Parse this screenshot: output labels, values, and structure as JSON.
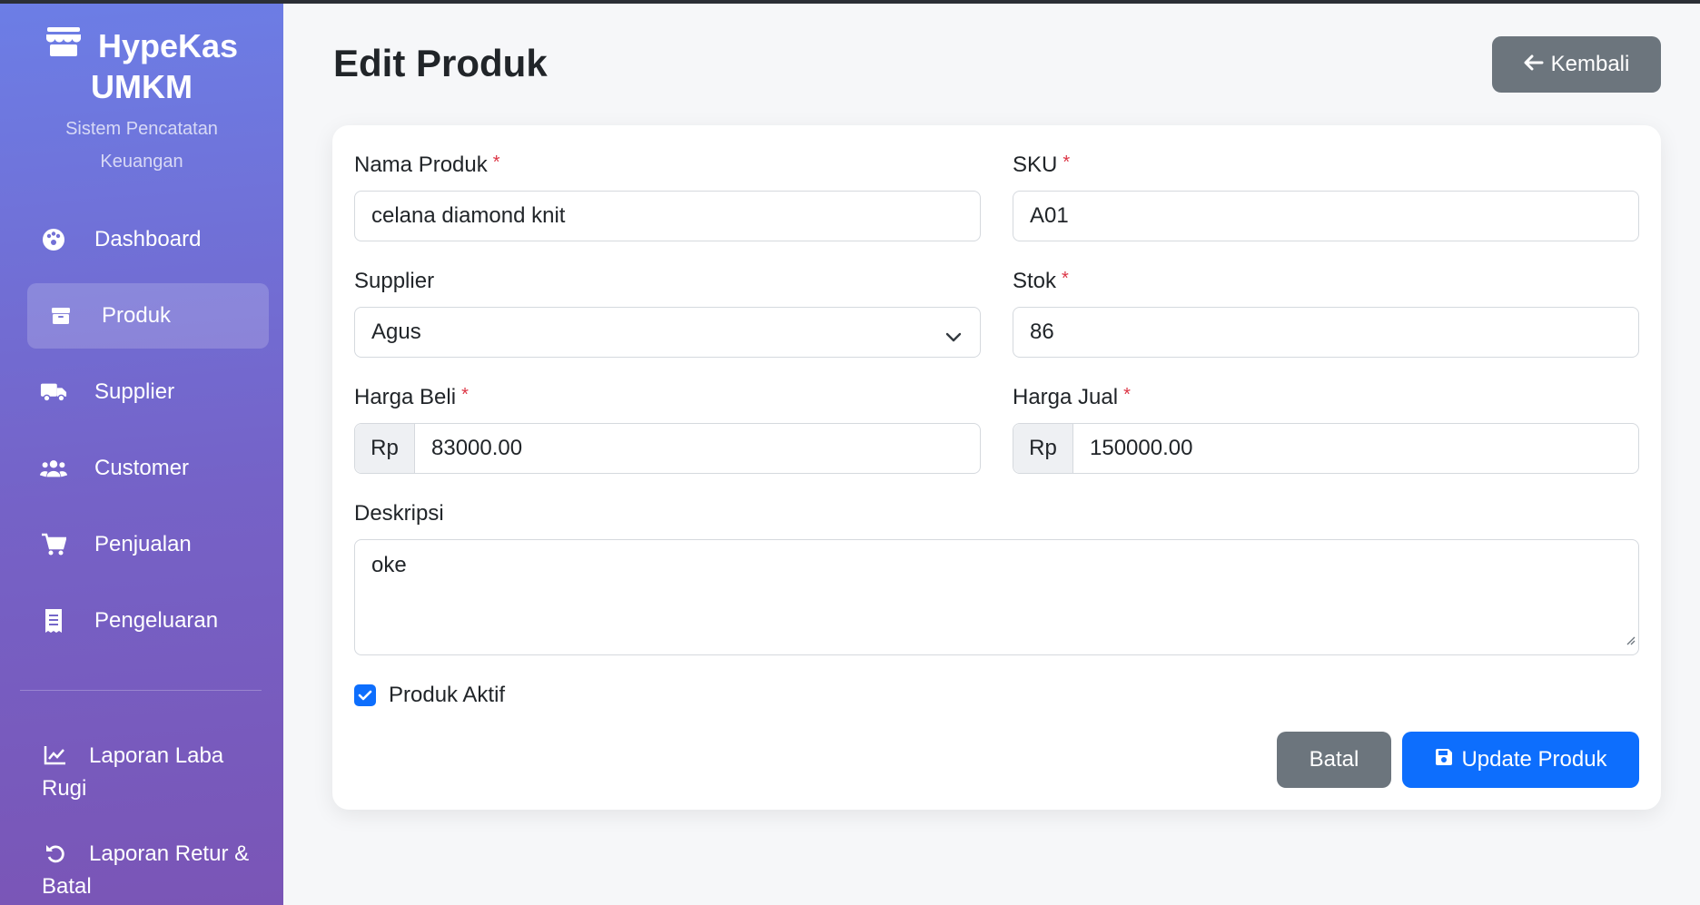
{
  "brand": {
    "name_line1": "HypeKas",
    "name_line2": "UMKM",
    "subtitle": "Sistem Pencatatan Keuangan"
  },
  "sidebar": {
    "items": [
      {
        "label": "Dashboard",
        "icon": "palette-icon"
      },
      {
        "label": "Produk",
        "icon": "box-icon",
        "active": true
      },
      {
        "label": "Supplier",
        "icon": "truck-icon"
      },
      {
        "label": "Customer",
        "icon": "users-icon"
      },
      {
        "label": "Penjualan",
        "icon": "cart-icon"
      },
      {
        "label": "Pengeluaran",
        "icon": "receipt-icon"
      }
    ],
    "reports": [
      {
        "label": "Laporan Laba Rugi",
        "icon": "chart-line-icon"
      },
      {
        "label": "Laporan Retur & Batal",
        "icon": "undo-icon"
      }
    ]
  },
  "page": {
    "title": "Edit Produk",
    "back_label": "Kembali"
  },
  "form": {
    "nama_produk": {
      "label": "Nama Produk",
      "value": "celana diamond knit"
    },
    "sku": {
      "label": "SKU",
      "value": "A01"
    },
    "supplier": {
      "label": "Supplier",
      "value": "Agus"
    },
    "stok": {
      "label": "Stok",
      "value": "86"
    },
    "harga_beli": {
      "label": "Harga Beli",
      "prefix": "Rp",
      "value": "83000.00"
    },
    "harga_jual": {
      "label": "Harga Jual",
      "prefix": "Rp",
      "value": "150000.00"
    },
    "deskripsi": {
      "label": "Deskripsi",
      "value": "oke"
    },
    "aktif": {
      "label": "Produk Aktif",
      "checked": true
    },
    "required_mark": "*",
    "cancel_label": "Batal",
    "submit_label": "Update Produk"
  },
  "colors": {
    "primary": "#0d6efd",
    "secondary": "#6c757d",
    "danger": "#dc3545",
    "sidebar_top": "#6c7ee6",
    "sidebar_bottom": "#7a55b6"
  }
}
